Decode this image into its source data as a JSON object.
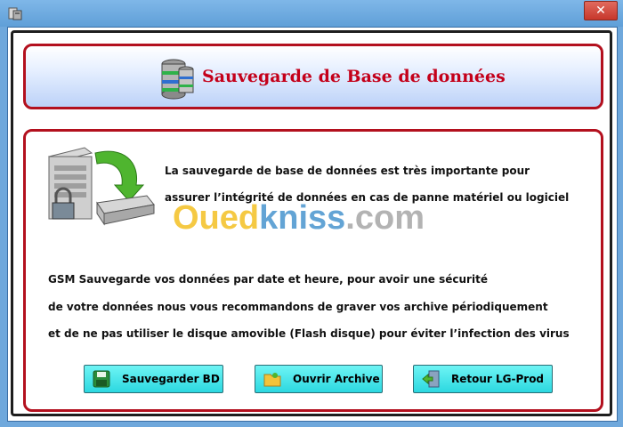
{
  "window": {
    "close_glyph": "✕"
  },
  "header": {
    "title": "Sauvegarde de Base de données",
    "icon": "database-icon"
  },
  "main": {
    "paragraph1": [
      "La sauvegarde de base de données est très importante pour",
      "assurer l’intégrité de données en cas de panne matériel ou logiciel"
    ],
    "paragraph2": [
      "GSM Sauvegarde vos données par date et heure, pour avoir une sécurité",
      "de votre données nous vous recommandons de graver vos archive périodiquement",
      " et de ne pas utiliser le disque amovible (Flash disque) pour éviter l’infection des virus"
    ],
    "watermark": {
      "part1": "Oued",
      "part2": "kniss",
      "part3": ".com"
    }
  },
  "buttons": {
    "backup": {
      "label": "Sauvegarder BD",
      "icon": "floppy-disk-icon"
    },
    "archive": {
      "label": "Ouvrir Archive",
      "icon": "folder-icon"
    },
    "back": {
      "label": "Retour  LG-Prod",
      "icon": "exit-door-icon"
    }
  },
  "colors": {
    "accent_red": "#c4001a",
    "button_cyan": "#2cd8e0",
    "titlebar_blue": "#6fa8dc"
  }
}
